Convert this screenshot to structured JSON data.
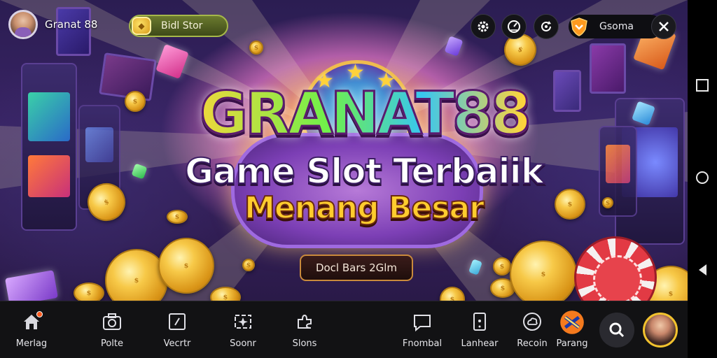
{
  "header": {
    "username": "Granat 88",
    "balance_label": "Bidl Stor",
    "search_label": "Gsoma"
  },
  "icons": {
    "settings": "gear-icon",
    "speed": "speedometer-icon",
    "refresh": "refresh-icon",
    "shield": "shield-icon",
    "close": "close-icon"
  },
  "hero": {
    "title": "GRANAT88",
    "subtitle_line1": "Game Slot Terbaiik",
    "subtitle_line2": "Menang Besar",
    "cta_label": "Docl Bars 2Glm"
  },
  "bottom_nav": {
    "items": [
      {
        "label": "Merlag",
        "icon": "home-icon"
      },
      {
        "label": "Polte",
        "icon": "camera-icon"
      },
      {
        "label": "Vecrtr",
        "icon": "slash-frame-icon"
      },
      {
        "label": "Soonr",
        "icon": "spark-frame-icon"
      },
      {
        "label": "Slons",
        "icon": "puzzle-icon"
      },
      {
        "label": "Fnombal",
        "icon": "chat-icon"
      },
      {
        "label": "Lanhear",
        "icon": "phone-icon"
      },
      {
        "label": "Recoin",
        "icon": "cloud-icon"
      },
      {
        "label": "Parang",
        "icon": "brand-logo-icon"
      }
    ]
  },
  "colors": {
    "accent_gold": "#ffcc2e",
    "nav_background": "#121214",
    "notification": "#ff5a1e"
  }
}
